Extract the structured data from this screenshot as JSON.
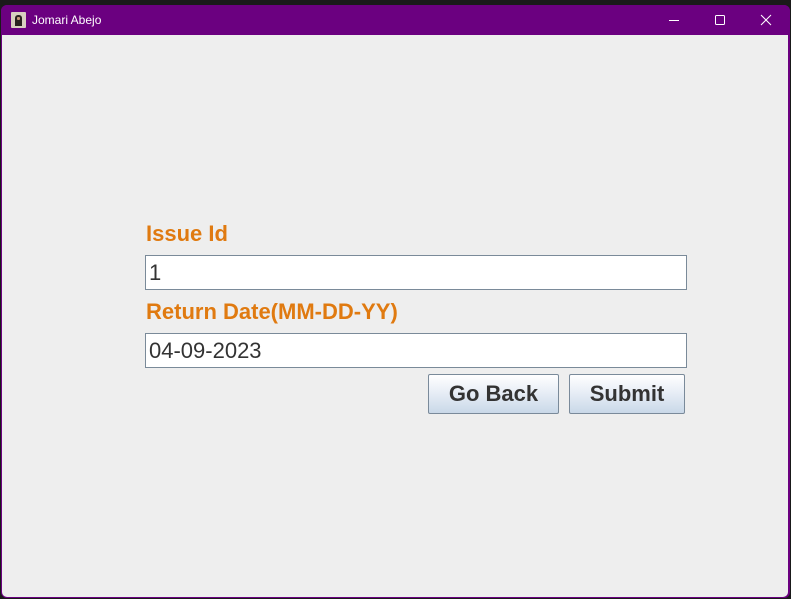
{
  "window": {
    "title": "Jomari Abejo",
    "icon": "app-photo-icon",
    "controls": [
      "minimize-icon",
      "maximize-icon",
      "close-icon"
    ]
  },
  "form": {
    "issue_id_label": "Issue Id",
    "issue_id_value": "1",
    "return_date_label": "Return Date(MM-DD-YY)",
    "return_date_value": "04-09-2023"
  },
  "buttons": {
    "go_back": "Go Back",
    "submit": "Submit"
  },
  "colors": {
    "titlebar": "#6b0080",
    "label": "#e07a10",
    "panel": "#eeeeee"
  }
}
